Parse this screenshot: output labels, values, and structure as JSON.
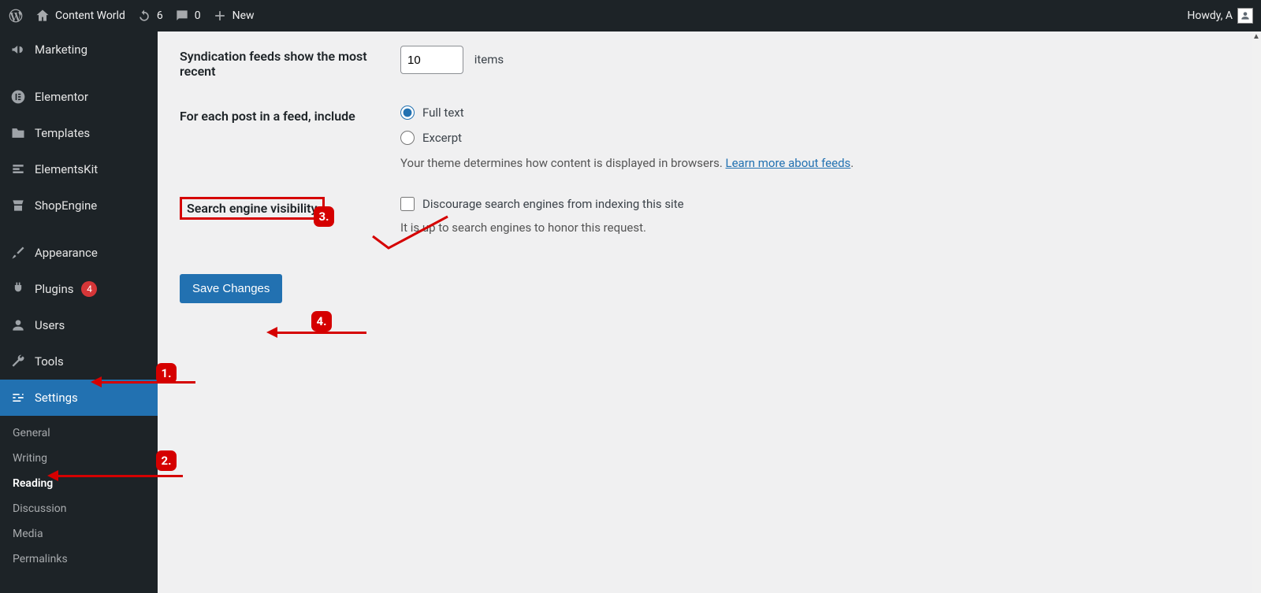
{
  "adminbar": {
    "site_name": "Content World",
    "updates_count": "6",
    "comments_count": "0",
    "new_label": "New",
    "howdy": "Howdy, A"
  },
  "sidebar": {
    "items": [
      {
        "key": "marketing",
        "label": "Marketing"
      },
      {
        "key": "elementor",
        "label": "Elementor"
      },
      {
        "key": "templates",
        "label": "Templates"
      },
      {
        "key": "elementskit",
        "label": "ElementsKit"
      },
      {
        "key": "shopengine",
        "label": "ShopEngine"
      },
      {
        "key": "appearance",
        "label": "Appearance"
      },
      {
        "key": "plugins",
        "label": "Plugins",
        "badge": "4"
      },
      {
        "key": "users",
        "label": "Users"
      },
      {
        "key": "tools",
        "label": "Tools"
      },
      {
        "key": "settings",
        "label": "Settings",
        "current": true
      }
    ],
    "submenu": [
      {
        "label": "General"
      },
      {
        "label": "Writing"
      },
      {
        "label": "Reading",
        "current": true
      },
      {
        "label": "Discussion"
      },
      {
        "label": "Media"
      },
      {
        "label": "Permalinks"
      }
    ]
  },
  "form": {
    "syndication_label": "Syndication feeds show the most recent",
    "syndication_value": "10",
    "syndication_suffix": "items",
    "feed_include_label": "For each post in a feed, include",
    "feed_full_text": "Full text",
    "feed_excerpt": "Excerpt",
    "feed_desc_prefix": "Your theme determines how content is displayed in browsers. ",
    "feed_desc_link": "Learn more about feeds",
    "sev_label": "Search engine visibility",
    "sev_checkbox_label": "Discourage search engines from indexing this site",
    "sev_desc": "It is up to search engines to honor this request.",
    "save_label": "Save Changes"
  },
  "annotations": {
    "b1": "1.",
    "b2": "2.",
    "b3": "3.",
    "b4": "4."
  }
}
